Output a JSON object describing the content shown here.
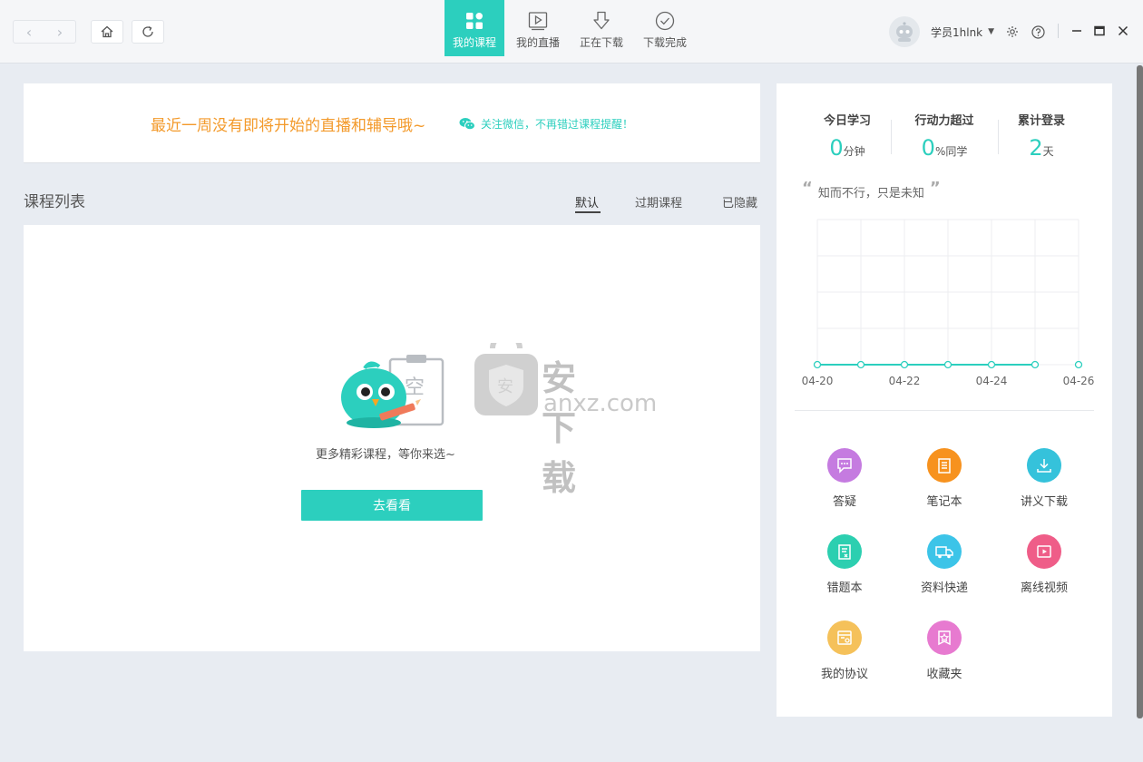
{
  "header": {
    "tabs": [
      {
        "label": "我的课程",
        "icon": "grid-icon",
        "active": true
      },
      {
        "label": "我的直播",
        "icon": "play-icon",
        "active": false
      },
      {
        "label": "正在下载",
        "icon": "download-arrow-icon",
        "active": false
      },
      {
        "label": "下载完成",
        "icon": "check-circle-icon",
        "active": false
      }
    ],
    "username": "学员1hlnk",
    "accent": "#2ccfbe"
  },
  "notice": {
    "text": "最近一周没有即将开始的直播和辅导哦~",
    "wechat_text": "关注微信，不再错过课程提醒！",
    "text_color": "#f39a2b"
  },
  "courses": {
    "title": "课程列表",
    "filters": [
      "默认",
      "过期课程",
      "已隐藏"
    ],
    "active_filter": "默认",
    "empty_badge": "空",
    "empty_text": "更多精彩课程，等你来选~",
    "go_button": "去看看",
    "watermark_big": "安下载",
    "watermark_small": "anxz.com",
    "watermark_shield": "安"
  },
  "stats": {
    "items": [
      {
        "label": "今日学习",
        "value": "0",
        "unit": "分钟"
      },
      {
        "label": "行动力超过",
        "value": "0",
        "unit": "%同学"
      },
      {
        "label": "累计登录",
        "value": "2",
        "unit": "天"
      }
    ],
    "quote": "知而不行，只是未知"
  },
  "chart_data": {
    "type": "line",
    "x": [
      "04-20",
      "04-21",
      "04-22",
      "04-23",
      "04-24",
      "04-25",
      "04-26"
    ],
    "tick_labels": [
      "04-20",
      "04-22",
      "04-24",
      "04-26"
    ],
    "values": [
      0,
      0,
      0,
      0,
      0,
      0,
      null
    ],
    "grid": true,
    "line_color": "#2ccfbe"
  },
  "tools": [
    {
      "label": "答疑",
      "icon": "chat-icon",
      "color": "#c57be0"
    },
    {
      "label": "笔记本",
      "icon": "notebook-icon",
      "color": "#f7921e"
    },
    {
      "label": "讲义下载",
      "icon": "download-icon",
      "color": "#35c2db"
    },
    {
      "label": "错题本",
      "icon": "wrong-book-icon",
      "color": "#2ccfb0"
    },
    {
      "label": "资料快递",
      "icon": "truck-icon",
      "color": "#3cc4e8"
    },
    {
      "label": "离线视频",
      "icon": "video-icon",
      "color": "#ef5d88"
    },
    {
      "label": "我的协议",
      "icon": "agreement-icon",
      "color": "#f5c15a"
    },
    {
      "label": "收藏夹",
      "icon": "favorites-icon",
      "color": "#e77ad0"
    }
  ]
}
